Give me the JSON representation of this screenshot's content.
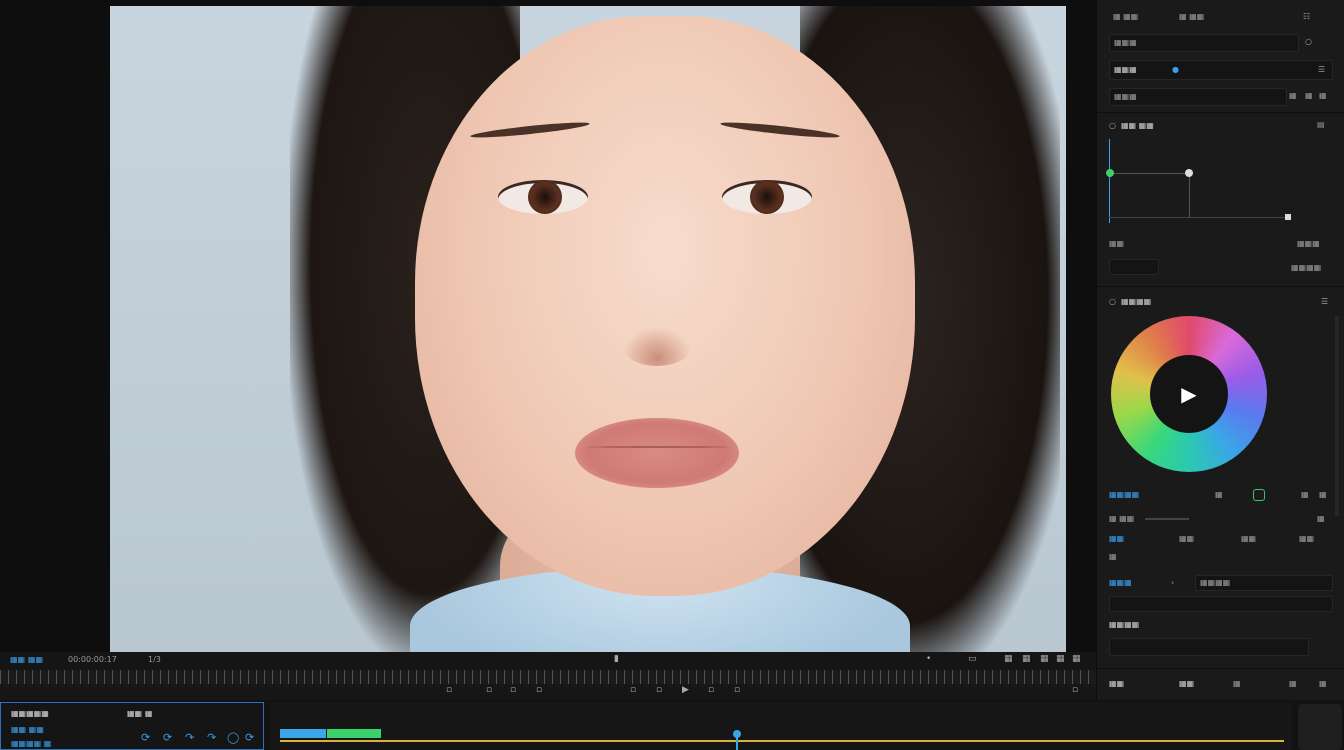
{
  "preview_toolbar": {
    "left_label": "▦▦ ▦▦",
    "timecode": "00:00:00:17",
    "page": "1/3"
  },
  "panel": {
    "tab_1": "▦ ▦▦",
    "tab_2": "▦ ▦▦",
    "search_placeholder": "▦▦▦",
    "preset_label": "▦▦▦",
    "name_field": "▦▦▦",
    "curve_title": "▦▦ ▦▦",
    "curve_footer_left": "▦▦",
    "curve_footer_right": "▦▦▦",
    "color_title": "▦▦▦▦",
    "color_mode": "▦▦▦▦",
    "hsl_label": "▦ ▦▦",
    "option_1": "▦▦",
    "option_2": "▦▦",
    "option_3": "▦▦",
    "option_4": "▦▦",
    "export_label": "▦▦▦",
    "export_value": "▦▦▦▦",
    "save_label": "▦▦▦▦",
    "bottom_btn_1": "▦▦",
    "bottom_btn_2": "▦▦"
  },
  "timeline": {
    "track_title": "▦▦▦▦▦",
    "track_sub1": "▦▦ ▦▦",
    "track_sub2": "▦▦▦▦ ▦",
    "tools_label": "▦▦ ▦"
  },
  "colors": {
    "accent_blue": "#3a9ee8",
    "accent_green": "#3ad06a",
    "timeline_yellow": "#d8b33a"
  }
}
